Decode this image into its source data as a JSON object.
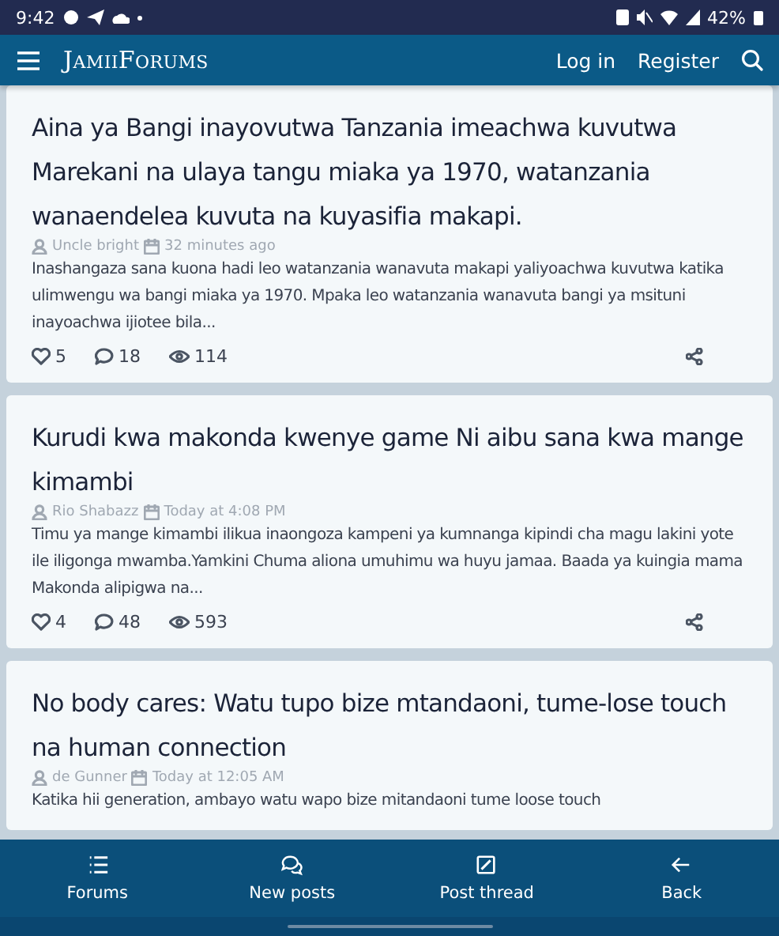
{
  "status_bar": {
    "time": "9:42",
    "battery": "42%"
  },
  "header": {
    "logo": "JamiiForums",
    "actions": [
      {
        "label": "Log in"
      },
      {
        "label": "Register"
      }
    ]
  },
  "threads": [
    {
      "title": "Aina ya Bangi inayovutwa Tanzania imeachwa kuvutwa Marekani na ulaya tangu miaka ya 1970, watanzania wanaendelea kuvuta na kuyasifia makapi.",
      "author": "Uncle bright",
      "date": "32 minutes ago",
      "snippet": "Inashangaza sana kuona hadi leo watanzania wanavuta makapi yaliyoachwa kuvutwa katika ulimwengu wa bangi miaka ya 1970. Mpaka leo watanzania wanavuta bangi ya msituni inayoachwa ijiotee bila...",
      "likes": "5",
      "replies": "18",
      "views": "114"
    },
    {
      "title": "Kurudi kwa makonda kwenye game Ni aibu sana kwa mange kimambi",
      "author": "Rio Shabazz",
      "date": "Today at 4:08 PM",
      "snippet": "Timu ya mange kimambi ilikua inaongoza kampeni ya kumnanga kipindi cha magu lakini yote ile iligonga mwamba.Yamkini Chuma aliona umuhimu wa huyu jamaa. Baada ya kuingia mama Makonda alipigwa na...",
      "likes": "4",
      "replies": "48",
      "views": "593"
    },
    {
      "title": "No body cares: Watu tupo bize mtandaoni, tume-lose touch na human connection",
      "author": "de Gunner",
      "date": "Today at 12:05 AM",
      "snippet": "Katika hii generation, ambayo watu wapo bize mitandaoni tume loose touch"
    }
  ],
  "bottom_nav": [
    {
      "kind": "forums",
      "label": "Forums"
    },
    {
      "kind": "new",
      "label": "New posts"
    },
    {
      "kind": "post",
      "label": "Post thread"
    },
    {
      "kind": "back",
      "label": "Back"
    }
  ]
}
